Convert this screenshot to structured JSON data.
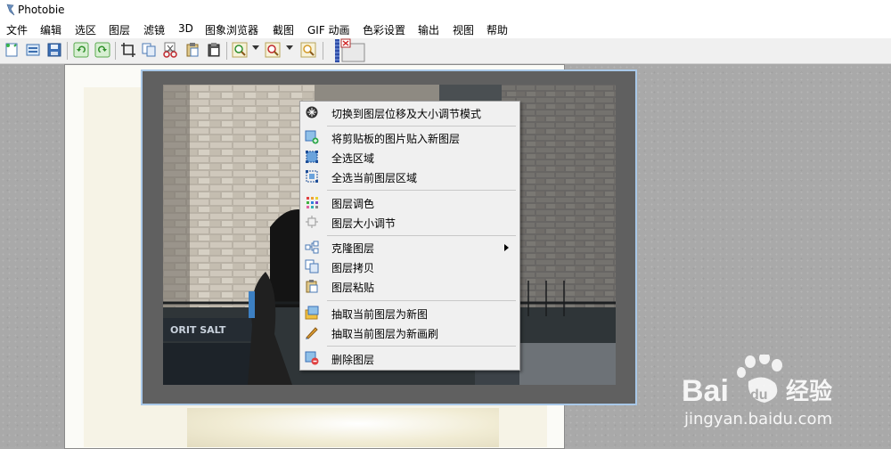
{
  "window": {
    "title": "Photobie"
  },
  "menu": [
    "文件",
    "编辑",
    "选区",
    "图层",
    "滤镜",
    "3D",
    "图象浏览器",
    "截图",
    "GIF 动画",
    "色彩设置",
    "输出",
    "视图",
    "帮助"
  ],
  "toolbar": {
    "buttons": [
      "new-file-icon",
      "open-file-icon",
      "save-icon",
      "undo-icon",
      "redo-icon",
      "crop-icon",
      "copy-icon",
      "cut-icon",
      "paste-icon",
      "paste-new-icon",
      "zoom-in-icon",
      "zoom-out-icon",
      "zoom-fit-icon",
      "close-document-icon"
    ]
  },
  "context_menu": {
    "items": [
      {
        "label": "切换到图层位移及大小调节模式",
        "icon": "move-resize-mode-icon"
      },
      {
        "label": "将剪贴板的图片贴入新图层",
        "icon": "paste-to-new-layer-icon"
      },
      {
        "label": "全选区域",
        "icon": "select-all-icon"
      },
      {
        "label": "全选当前图层区域",
        "icon": "select-layer-area-icon"
      },
      {
        "label": "图层调色",
        "icon": "layer-color-adjust-icon"
      },
      {
        "label": "图层大小调节",
        "icon": "layer-resize-icon"
      },
      {
        "label": "克隆图层",
        "icon": "clone-layer-icon",
        "submenu": true
      },
      {
        "label": "图层拷贝",
        "icon": "layer-copy-icon"
      },
      {
        "label": "图层粘贴",
        "icon": "layer-paste-icon"
      },
      {
        "label": "抽取当前图层为新图",
        "icon": "extract-new-image-icon"
      },
      {
        "label": "抽取当前图层为新画刷",
        "icon": "extract-new-brush-icon"
      },
      {
        "label": "删除图层",
        "icon": "delete-layer-icon"
      }
    ]
  },
  "photo": {
    "sign_text": "ORIT SALT"
  },
  "watermark": {
    "brand": "Bai",
    "brand2": "du",
    "cn": "经验",
    "url": "jingyan.baidu.com"
  },
  "colors": {
    "menu_bg": "#f0f0f0",
    "workspace": "#ababab",
    "layer_frame": "#a9c8e8"
  }
}
